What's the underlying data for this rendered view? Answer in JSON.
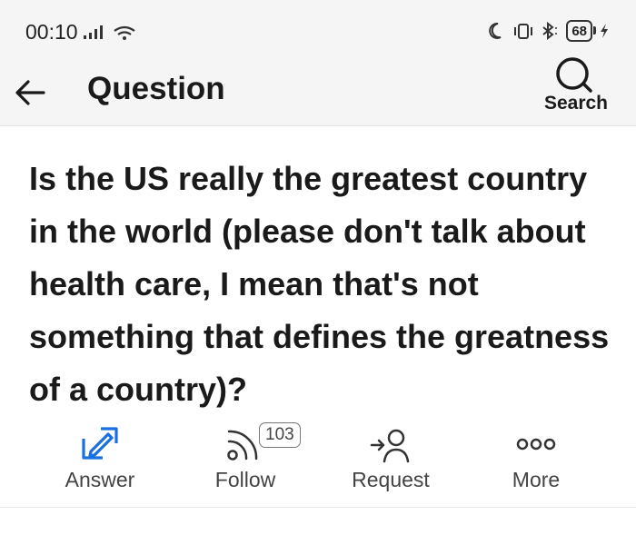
{
  "status": {
    "time": "00:10",
    "battery": "68"
  },
  "header": {
    "title": "Question",
    "search_label": "Search"
  },
  "question": {
    "text": "Is the US really the greatest country in the world (please don't talk about health care, I mean that's not something that defines the greatness of a country)?"
  },
  "actions": [
    {
      "label": "Answer",
      "icon": "pen-square-icon",
      "color": "#1a6fe0"
    },
    {
      "label": "Follow",
      "icon": "rss-icon",
      "count": "103"
    },
    {
      "label": "Request",
      "icon": "add-user-icon"
    },
    {
      "label": "More",
      "icon": "dots-icon"
    }
  ]
}
